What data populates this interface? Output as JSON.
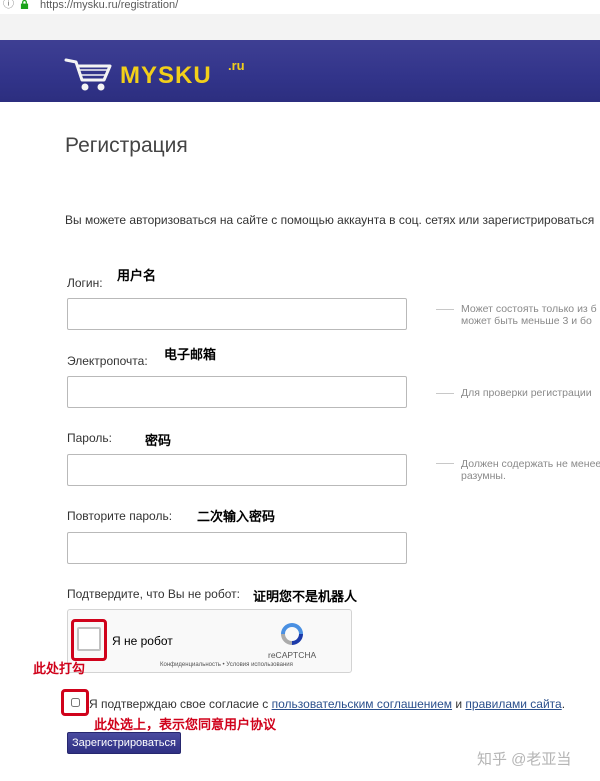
{
  "browser": {
    "url": "https://mysku.ru/registration/"
  },
  "header": {
    "logo_text": "MYSKU",
    "logo_tld": ".ru",
    "bg_color": "#32348a",
    "logo_color": "#f2cf1a"
  },
  "page": {
    "title": "Регистрация",
    "intro": "Вы можете авторизоваться на сайте с помощью аккаунта в соц. сетях или зарегистрироваться"
  },
  "form": {
    "login": {
      "label": "Логин:",
      "annotation": "用户名",
      "value": "",
      "hint": [
        "Может состоять только из б",
        "может быть меньше 3 и бо"
      ]
    },
    "email": {
      "label": "Электропочта:",
      "annotation": "电子邮箱",
      "value": "",
      "hint": [
        "Для проверки регистрации"
      ]
    },
    "password": {
      "label": "Пароль:",
      "annotation": "密码",
      "value": "",
      "hint": [
        "Должен содержать не менее",
        "разумны."
      ]
    },
    "password_repeat": {
      "label": "Повторите пароль:",
      "annotation": "二次输入密码",
      "value": ""
    },
    "robot": {
      "label": "Подтвердите, что Вы не робот:",
      "annotation": "证明您不是机器人"
    },
    "captcha": {
      "checkbox_label": "Я не робот",
      "brand": "reCAPTCHA",
      "links": "Конфиденциальность • Условия использования",
      "checked": false
    },
    "captcha_annotation": "此处打勾",
    "agree": {
      "prefix": "Я подтверждаю свое согласие с ",
      "link1": "пользовательским соглашением",
      "middle": " и ",
      "link2": "правилами сайта",
      "suffix": ".",
      "checked": false
    },
    "agree_annotation": "此处选上，表示您同意用户协议",
    "submit_label": "Зарегистрироваться"
  },
  "watermark": "知乎 @老亚当",
  "annotation_color": "#d0021b"
}
